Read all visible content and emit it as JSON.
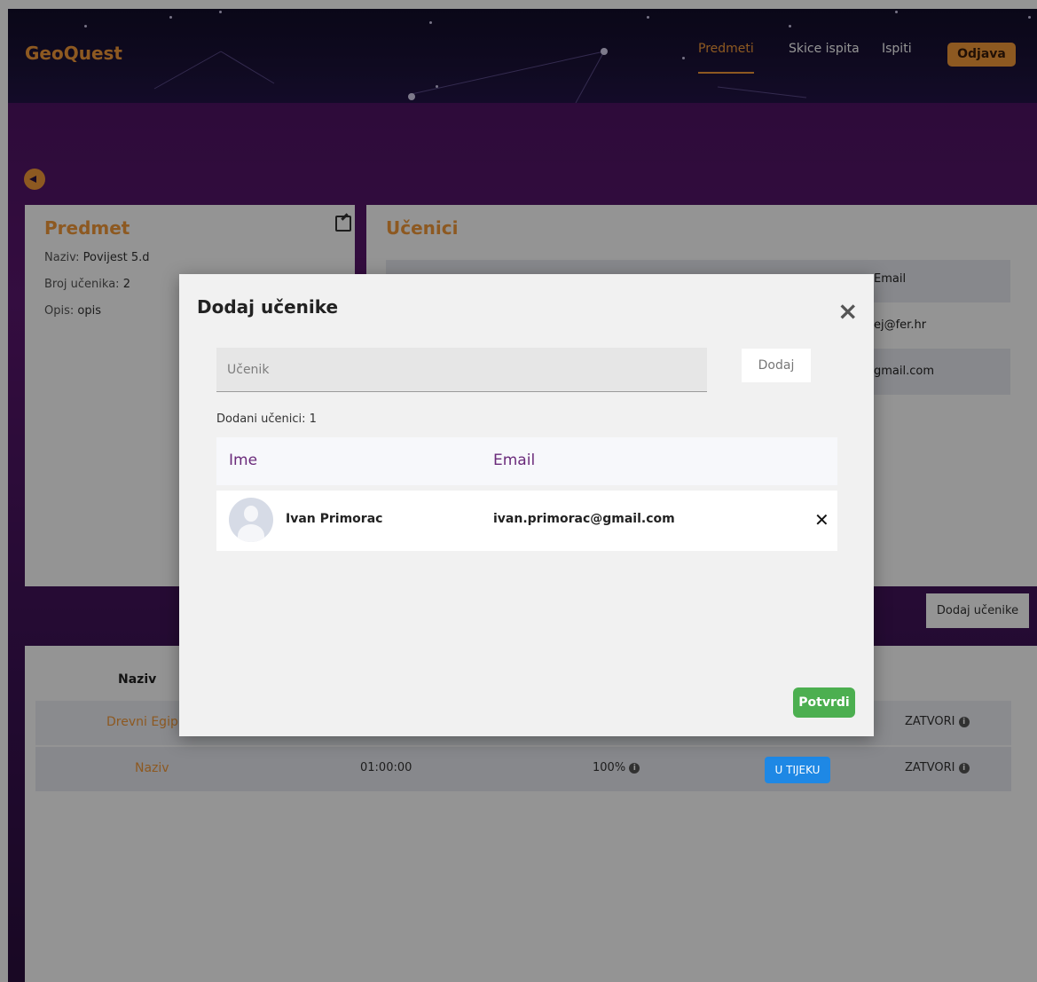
{
  "header": {
    "brand": "GeoQuest",
    "nav": [
      {
        "label": "Predmeti"
      },
      {
        "label": "Skice ispita"
      },
      {
        "label": "Ispiti"
      }
    ],
    "logout_label": "Odjava"
  },
  "subject_panel": {
    "title": "Predmet",
    "fields": [
      {
        "label": "Naziv:",
        "value": "Povijest 5.d"
      },
      {
        "label": "Broj učenika:",
        "value": "2"
      },
      {
        "label": "Opis:",
        "value": "opis"
      }
    ]
  },
  "students_panel": {
    "title": "Učenici",
    "email_header": "Email",
    "rows": [
      {
        "email_partial": "ej@fer.hr"
      },
      {
        "email_partial": "gmail.com"
      }
    ],
    "add_button_label": "Dodaj učenike"
  },
  "exams_table": {
    "header_naziv": "Naziv",
    "rows": [
      {
        "name": "Drevni Egip",
        "action": "ZATVORI"
      },
      {
        "name": "Naziv",
        "duration": "01:00:00",
        "score": "100%",
        "status": "U TIJEKU",
        "action": "ZATVORI"
      }
    ]
  },
  "modal": {
    "title": "Dodaj učenike",
    "student_placeholder": "Učenik",
    "add_label": "Dodaj",
    "added_label": "Dodani učenici: 1",
    "columns": {
      "name": "Ime",
      "email": "Email"
    },
    "students": [
      {
        "name": "Ivan Primorac",
        "email": "ivan.primorac@gmail.com"
      }
    ],
    "confirm_label": "Potvrdi"
  },
  "colors": {
    "accent": "#f39a3a",
    "confirm": "#4caf50",
    "status_blue": "#1e88e5",
    "header_purple": "#6a2a7a"
  }
}
